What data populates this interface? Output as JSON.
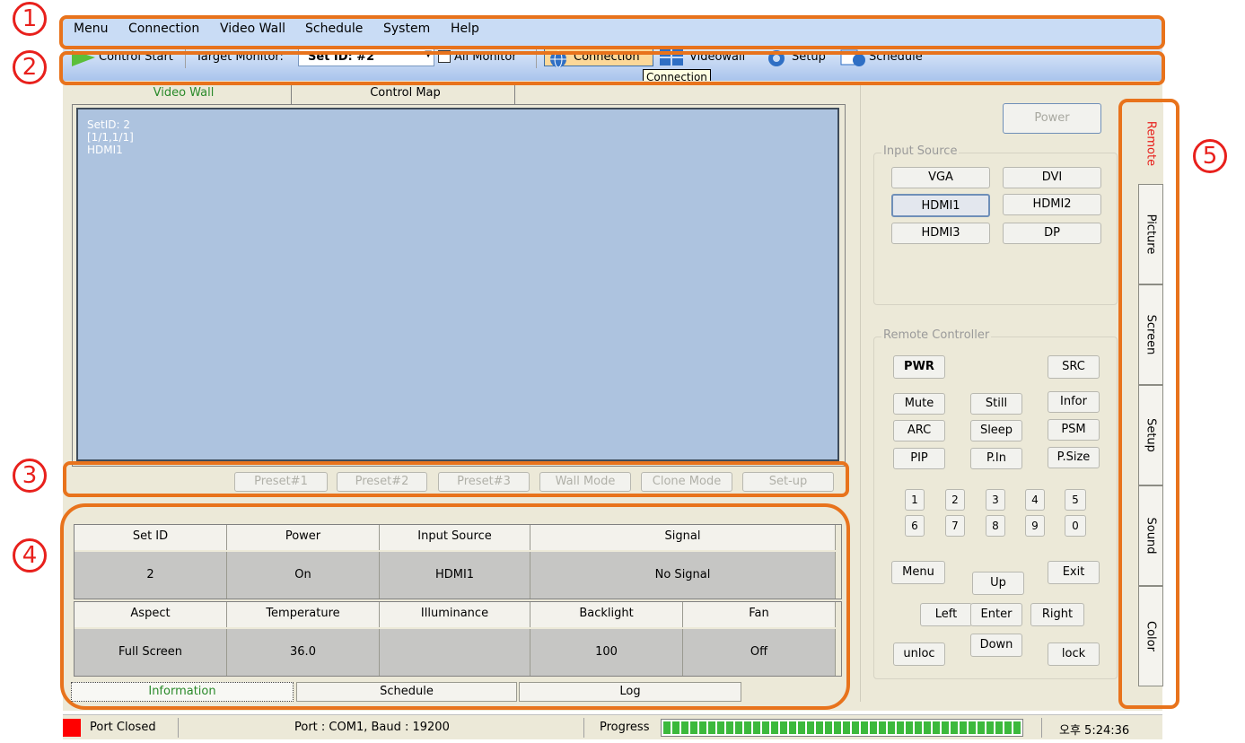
{
  "menu": [
    "Menu",
    "Connection",
    "Video Wall",
    "Schedule",
    "System",
    "Help"
  ],
  "toolbar": {
    "control_start": "Control Start",
    "target_monitor": "Target Monitor:",
    "set_id": "Set ID: #2",
    "all_monitor": "All Monitor",
    "connection": "Connection",
    "videowall": "Videowall",
    "setup": "Setup",
    "schedule": "Schedule",
    "tooltip": "Connection"
  },
  "callouts": [
    "1",
    "2",
    "3",
    "4",
    "5"
  ],
  "tabs": {
    "video_wall": "Video Wall",
    "control_map": "Control Map"
  },
  "wall_cell": {
    "set_id": "SetID: 2",
    "pos": "[1/1,1/1]",
    "source": "HDMI1"
  },
  "presets": [
    "Preset#1",
    "Preset#2",
    "Preset#3",
    "Wall Mode",
    "Clone Mode",
    "Set-up"
  ],
  "info_table": {
    "row1_headers": [
      "Set ID",
      "Power",
      "Input Source",
      "Signal"
    ],
    "row1_values": [
      "2",
      "On",
      "HDMI1",
      "No Signal"
    ],
    "row2_headers": [
      "Aspect",
      "Temperature",
      "Illuminance",
      "Backlight",
      "Fan"
    ],
    "row2_values": [
      "Full Screen",
      "36.0",
      "",
      "100",
      "Off"
    ]
  },
  "bottom_tabs": [
    "Information",
    "Schedule",
    "Log"
  ],
  "power_button": "Power",
  "input_source": {
    "label": "Input Source",
    "buttons": [
      "VGA",
      "DVI",
      "HDMI1",
      "HDMI2",
      "HDMI3",
      "DP"
    ]
  },
  "remote": {
    "label": "Remote Controller",
    "pwr": "PWR",
    "src": "SRC",
    "row1": [
      "Mute",
      "Still",
      "Infor"
    ],
    "row2": [
      "ARC",
      "Sleep",
      "PSM"
    ],
    "row3": [
      "PIP",
      "P.In",
      "P.Size"
    ],
    "num1": [
      "1",
      "2",
      "3",
      "4",
      "5"
    ],
    "num2": [
      "6",
      "7",
      "8",
      "9",
      "0"
    ],
    "menu": "Menu",
    "up": "Up",
    "exit": "Exit",
    "left": "Left",
    "enter": "Enter",
    "right": "Right",
    "unlock": "unloc",
    "down": "Down",
    "lock": "lock"
  },
  "side_tabs": [
    "Remote",
    "Picture",
    "Screen",
    "Setup",
    "Sound",
    "Color"
  ],
  "status": {
    "port_state": "Port Closed",
    "port": "Port : COM1,  Baud : 19200",
    "progress_label": "Progress",
    "progress": 1.0,
    "time": "오후 5:24:36"
  },
  "colors": {
    "accent_orange": "#e8731c",
    "callout_red": "#e8201c",
    "wall_blue": "#adc3df",
    "progress_green": "#3cb93c",
    "port_red": "#ff0000"
  }
}
